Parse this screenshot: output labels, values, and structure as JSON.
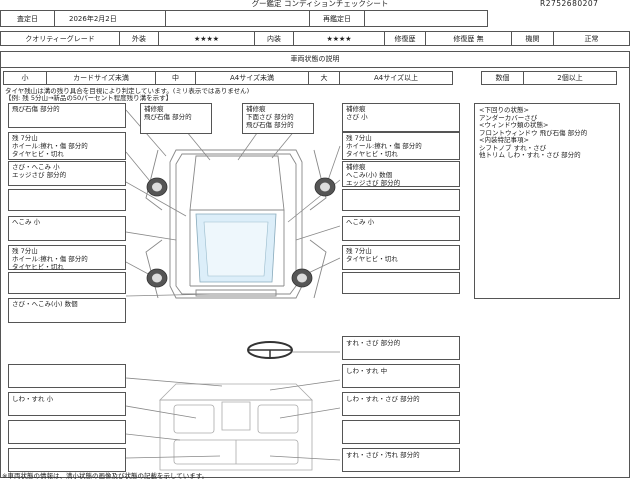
{
  "header": {
    "title": "グー鑑定 コンディションチェックシート",
    "doc_no": "R2752680207",
    "inspection_date_label": "査定日",
    "inspection_date": "2026年2月2日",
    "reinspection_label": "再鑑定日",
    "reinspection_value": ""
  },
  "grade_row": {
    "quality_label": "クオリティーグレード",
    "exterior_label": "外装",
    "exterior_stars": "★★★★",
    "interior_label": "内装",
    "interior_stars": "★★★★",
    "repair_label": "修復歴",
    "repair_history": "修復歴 無",
    "instruments_label": "機関",
    "instruments_value": "正常"
  },
  "legend": {
    "title": "車両状態の説明",
    "small": "小",
    "small_desc": "カードサイズ未満",
    "medium": "中",
    "medium_desc": "A4サイズ未満",
    "large": "大",
    "large_desc": "A4サイズ以上",
    "count_label": "数個",
    "count_desc": "2個以上"
  },
  "tire_note": {
    "line1": "タイヤ残山は溝の残り具合を目視により判定しています。(ミリ表示ではありません)",
    "line2": "【例: 残 5分山→新品の50パーセント程度残り溝を示す】"
  },
  "notes": {
    "left_1": [
      "飛び石傷 部分的"
    ],
    "left_2": [
      "残 7分山",
      "ホイール:擦れ・傷 部分的",
      "タイヤヒビ・切れ"
    ],
    "left_3": [
      "さび・へこみ 小",
      "エッジさび 部分的"
    ],
    "left_4": [
      "へこみ 小"
    ],
    "left_5": [
      "残 7分山",
      "ホイール:擦れ・傷 部分的",
      "タイヤヒビ・切れ"
    ],
    "left_6": [
      "さび・へこみ(小) 数個"
    ],
    "top_1": [
      "補修痕",
      "飛び石傷 部分的"
    ],
    "top_2": [
      "補修痕",
      "下面さび 部分的",
      "飛び石傷 部分的"
    ],
    "top_3": [
      "補修痕",
      "さび 小"
    ],
    "right_1": [
      "残 7分山",
      "ホイール:擦れ・傷 部分的",
      "タイヤヒビ・切れ"
    ],
    "right_2": [
      "補修痕",
      "へこみ(小) 数個",
      "エッジさび 部分的"
    ],
    "right_3": [
      "へこみ 小"
    ],
    "right_4": [
      "残 7分山",
      "タイヤヒビ・切れ"
    ],
    "side_info": [
      "<下回りの状態>",
      "アンダーカバーさび",
      "",
      "<ウィンドウ類の状態>",
      "フロントウィンドウ 飛び石傷 部分的",
      "",
      "<内装特記事項>",
      "シフトノブ すれ・さび",
      "他トリム しわ・すれ・さび 部分的"
    ],
    "int_right_1": [
      "すれ・さび 部分的"
    ],
    "int_right_2": [
      "しわ・すれ 中"
    ],
    "int_right_3": [
      "しわ・すれ・さび 部分的"
    ],
    "int_right_4": [
      "すれ・さび・汚れ 部分的"
    ],
    "int_left_1": [
      "しわ・すれ 小"
    ]
  },
  "footer": {
    "text": "※車両状態の情報は、満小状態の画像及び状態の記載を示しています。"
  }
}
